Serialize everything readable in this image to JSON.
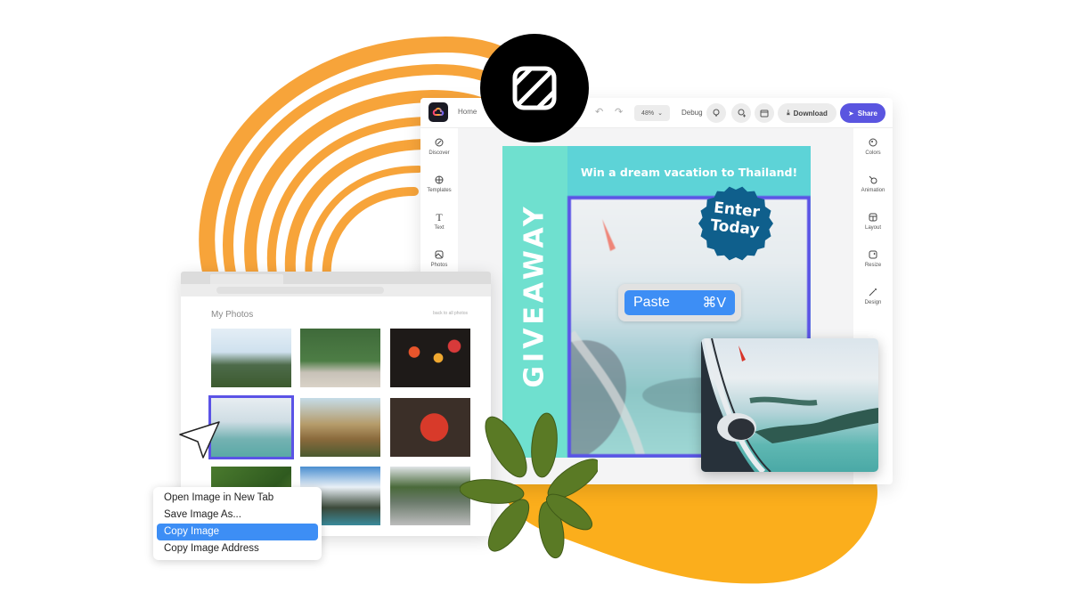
{
  "editor": {
    "home_label": "Home",
    "zoom_level": "48%",
    "debug_label": "Debug",
    "download_label": "Download",
    "share_label": "Share",
    "left_rail": [
      {
        "label": "Discover",
        "icon": "compass-icon"
      },
      {
        "label": "Templates",
        "icon": "templates-icon"
      },
      {
        "label": "Text",
        "icon": "text-icon"
      },
      {
        "label": "Photos",
        "icon": "photos-icon"
      }
    ],
    "right_rail": [
      {
        "label": "Colors",
        "icon": "palette-icon"
      },
      {
        "label": "Animation",
        "icon": "animation-icon"
      },
      {
        "label": "Layout",
        "icon": "layout-icon"
      },
      {
        "label": "Resize",
        "icon": "resize-icon"
      },
      {
        "label": "Design",
        "icon": "magic-wand-icon"
      }
    ],
    "accent_color": "#5a55e0"
  },
  "poster": {
    "headline": "Win a dream vacation to Thailand!",
    "side_text": "GIVEAWAY",
    "badge_line1": "Enter",
    "badge_line2": "Today",
    "side_color": "#6fe0cf",
    "top_color": "#5dd3d7",
    "badge_color": "#0f5f8c"
  },
  "paste_menu": {
    "label": "Paste",
    "shortcut": "⌘V"
  },
  "browser": {
    "title": "My Photos",
    "back_link": "back to all photos",
    "photos": [
      "Mountain landscape",
      "Temple courtyard with monk",
      "Lanterns at night",
      "Airplane window view",
      "Golden temple",
      "Food platter",
      "Green foliage",
      "Limestone cliff by the sea",
      "Street market"
    ]
  },
  "context_menu": {
    "items": [
      "Open Image in New Tab",
      "Save Image As...",
      "Copy Image",
      "Copy Image Address"
    ],
    "active_index": 2
  }
}
